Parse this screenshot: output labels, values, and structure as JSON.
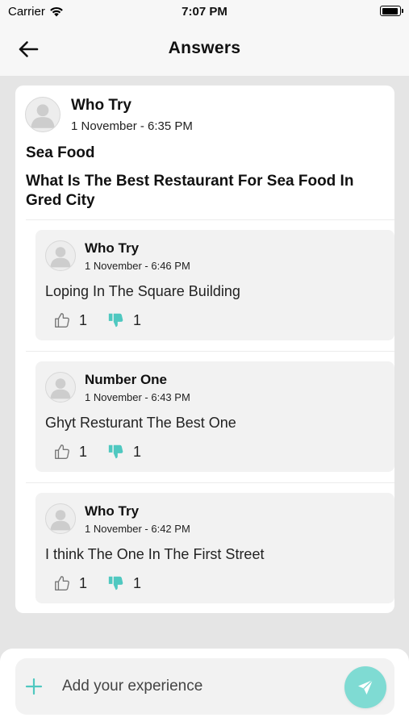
{
  "status_bar": {
    "carrier": "Carrier",
    "time": "7:07 PM"
  },
  "nav": {
    "title": "Answers",
    "back_icon": "arrow-left-icon"
  },
  "question": {
    "author": "Who Try",
    "date": "1 November - 6:35 PM",
    "title": "Sea Food",
    "body": "What Is The Best Restaurant For Sea Food In Gred City"
  },
  "answers": [
    {
      "author": "Who Try",
      "date": "1 November - 6:46 PM",
      "text": "Loping In The Square Building",
      "likes": "1",
      "dislikes": "1"
    },
    {
      "author": "Number One",
      "date": "1 November - 6:43 PM",
      "text": "Ghyt Resturant The Best One",
      "likes": "1",
      "dislikes": "1"
    },
    {
      "author": "Who Try",
      "date": "1 November - 6:42 PM",
      "text": "I think The One In The First Street",
      "likes": "1",
      "dislikes": "1"
    }
  ],
  "composer": {
    "placeholder": "Add your experience",
    "value": ""
  },
  "colors": {
    "accent": "#4fc8c0",
    "send_bg": "#7fdbd3",
    "background": "#e5e5e5"
  },
  "icons": {
    "like": "thumbs-up-icon",
    "dislike": "thumbs-down-icon",
    "add": "plus-icon",
    "send": "send-icon",
    "avatar": "avatar-placeholder-icon"
  }
}
